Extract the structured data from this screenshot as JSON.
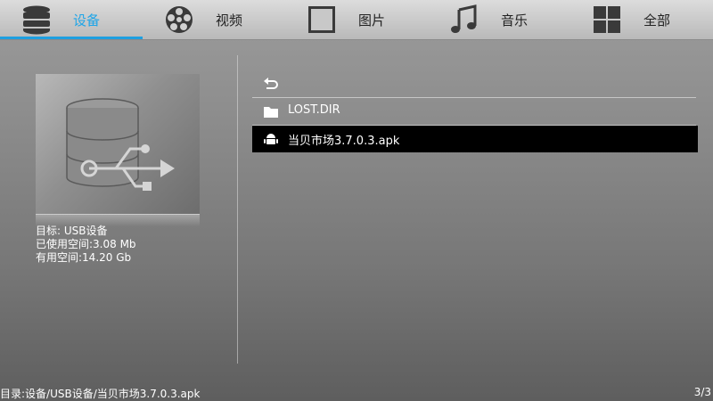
{
  "tabs": [
    {
      "label": "设备",
      "icon": "database-icon",
      "active": true
    },
    {
      "label": "视频",
      "icon": "film-reel-icon",
      "active": false
    },
    {
      "label": "图片",
      "icon": "picture-frame-icon",
      "active": false
    },
    {
      "label": "音乐",
      "icon": "music-note-icon",
      "active": false
    },
    {
      "label": "全部",
      "icon": "grid-icon",
      "active": false
    }
  ],
  "device": {
    "icon": "usb-storage-icon",
    "target": "目标: USB设备",
    "used": "已使用空间:3.08 Mb",
    "free": "有用空间:14.20 Gb"
  },
  "files": [
    {
      "label": "",
      "icon": "back-arrow-icon"
    },
    {
      "label": "LOST.DIR",
      "icon": "folder-icon"
    },
    {
      "label": "当贝市场3.7.0.3.apk",
      "icon": "android-icon",
      "selected": true
    }
  ],
  "status": {
    "path": "目录:设备/USB设备/当贝市场3.7.0.3.apk",
    "count": "3/3"
  },
  "colors": {
    "accent": "#1e9fe0",
    "selected_row": "#000000"
  }
}
